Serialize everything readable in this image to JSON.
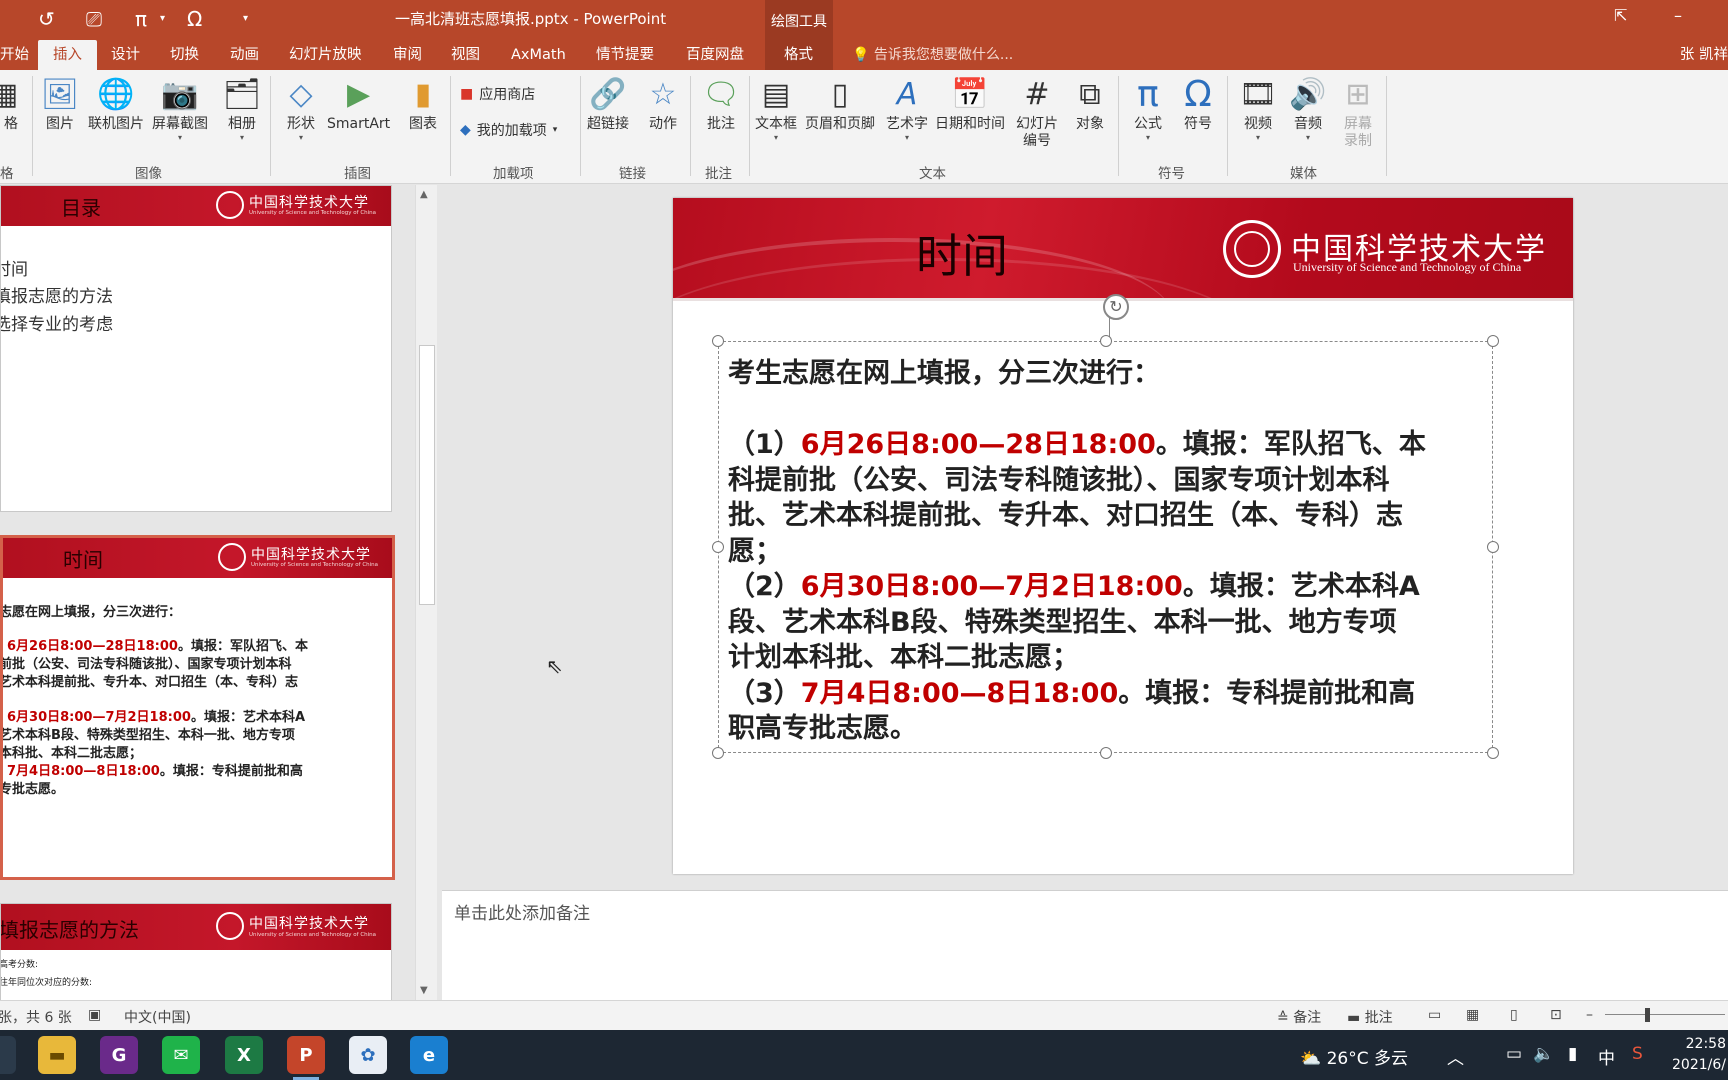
{
  "titlebar": {
    "document_title": "一高北清班志愿填报.pptx - PowerPoint",
    "drawing_tools": "绘图工具",
    "qat_pi": "π",
    "qat_omega": "Ω",
    "min": "–",
    "restore": "⧉"
  },
  "tabs": [
    "开始",
    "插入",
    "设计",
    "切换",
    "动画",
    "幻灯片放映",
    "审阅",
    "视图",
    "AxMath",
    "情节提要",
    "百度网盘",
    "格式"
  ],
  "active_tab": "插入",
  "tell_me": "告诉我您想要做什么...",
  "user": "张 凯祥",
  "ribbon": {
    "table_partial": "格",
    "table_group_partial": "格",
    "picture": "图片",
    "online_picture": "联机图片",
    "screenshot": "屏幕截图",
    "album": "相册",
    "group_images": "图像",
    "shapes": "形状",
    "smartart": "SmartArt",
    "chart": "图表",
    "group_illustrations": "插图",
    "store": "应用商店",
    "my_addins": "我的加载项",
    "group_addins": "加载项",
    "hyperlink": "超链接",
    "action": "动作",
    "group_links": "链接",
    "comment": "批注",
    "group_comments": "批注",
    "textbox": "文本框",
    "header_footer": "页眉和页脚",
    "wordart": "艺术字",
    "datetime": "日期和时间",
    "slide_number_line1": "幻灯片",
    "slide_number_line2": "编号",
    "object": "对象",
    "group_text": "文本",
    "equation": "公式",
    "symbol": "符号",
    "group_symbols": "符号",
    "video": "视频",
    "audio": "音频",
    "screen_rec_line1": "屏幕",
    "screen_rec_line2": "录制",
    "group_media": "媒体"
  },
  "thumbnails": {
    "t1_title": "目录",
    "t1_items": [
      "时间",
      "填报志愿的方法",
      "选择专业的考虑"
    ],
    "t2_title": "时间",
    "t2_line1": "志愿在网上填报，分三次进行：",
    "t2_line2a": "6月26日8:00—28日18:00",
    "t2_line2b": "。填报：军队招飞、本",
    "t2_line3": "前批（公安、司法专科随该批）、国家专项计划本科",
    "t2_line4": "艺术本科提前批、专升本、对口招生（本、专科）志",
    "t2_line5a": "6月30日8:00—7月2日18:00",
    "t2_line5b": "。填报：艺术本科A",
    "t2_line6": "艺术本科B段、特殊类型招生、本科一批、地方专项",
    "t2_line7": "本科批、本科二批志愿；",
    "t2_line8a": "7月4日8:00—8日18:00",
    "t2_line8b": "。填报：专科提前批和高",
    "t2_line9": "专批志愿。",
    "t3_title": "填报志愿的方法",
    "t3_line1": "高考分数:",
    "t3_line2": "往年同位次对应的分数:",
    "uni_cn": "中国科学技术大学",
    "uni_en": "University of Science and Technology of China"
  },
  "slide": {
    "title": "时间",
    "uni_cn": "中国科学技术大学",
    "uni_en": "University of Science and Technology of China",
    "line_intro": "考生志愿在网上填报，分三次进行：",
    "p1_prefix": "（1）",
    "p1_time": "6月26日8:00—28日18:00",
    "p1_rest": "。填报：军队招飞、本",
    "p1_l2": "科提前批（公安、司法专科随该批）、国家专项计划本科",
    "p1_l3": "批、艺术本科提前批、专升本、对口招生（本、专科）志",
    "p1_l4": "愿；",
    "p2_prefix": "（2）",
    "p2_time": "6月30日8:00—7月2日18:00",
    "p2_rest": "。填报：艺术本科A",
    "p2_l2": "段、艺术本科B段、特殊类型招生、本科一批、地方专项",
    "p2_l3": "计划本科批、本科二批志愿；",
    "p3_prefix": "（3）",
    "p3_time": "7月4日8:00—8日18:00",
    "p3_rest": "。填报：专科提前批和高",
    "p3_l2": "职高专批志愿。"
  },
  "notes_placeholder": "单击此处添加备注",
  "status": {
    "slide_count": "张，共 6 张",
    "language": "中文(中国)",
    "notes": "备注",
    "comments": "批注"
  },
  "taskbar": {
    "weather": "26°C 多云",
    "ime": "中",
    "time": "22:58",
    "date": "2021/6/"
  }
}
